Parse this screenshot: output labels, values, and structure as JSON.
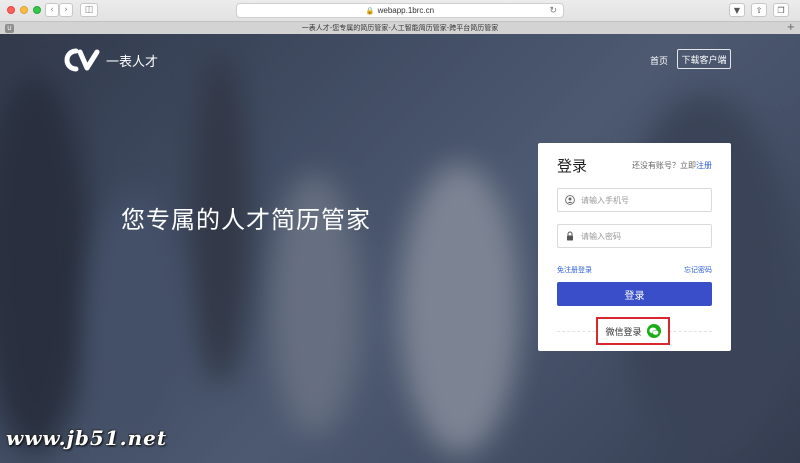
{
  "browser": {
    "url": "webapp.1brc.cn",
    "tab_title": "一表人才-您专属的简历管家-人工智能简历管家-跨平台简历管家",
    "tab_favicon": "U"
  },
  "header": {
    "logo_text": "一表人才",
    "nav_home": "首页",
    "nav_download": "下载客户端"
  },
  "hero": {
    "slogan": "您专属的人才简历管家"
  },
  "login": {
    "title": "登录",
    "no_account_prompt": "还没有账号？立即",
    "register_link": "注册",
    "phone_placeholder": "请输入手机号",
    "password_placeholder": "请输入密码",
    "free_register": "免注册登录",
    "forgot_password": "忘记密码",
    "login_button": "登录",
    "wechat_login": "微信登录"
  },
  "watermark": "www.jb51.net",
  "colors": {
    "primary_button": "#3a4ec9",
    "link": "#2e60d8",
    "highlight_box": "#d9272e",
    "wechat_green": "#1aad19"
  }
}
